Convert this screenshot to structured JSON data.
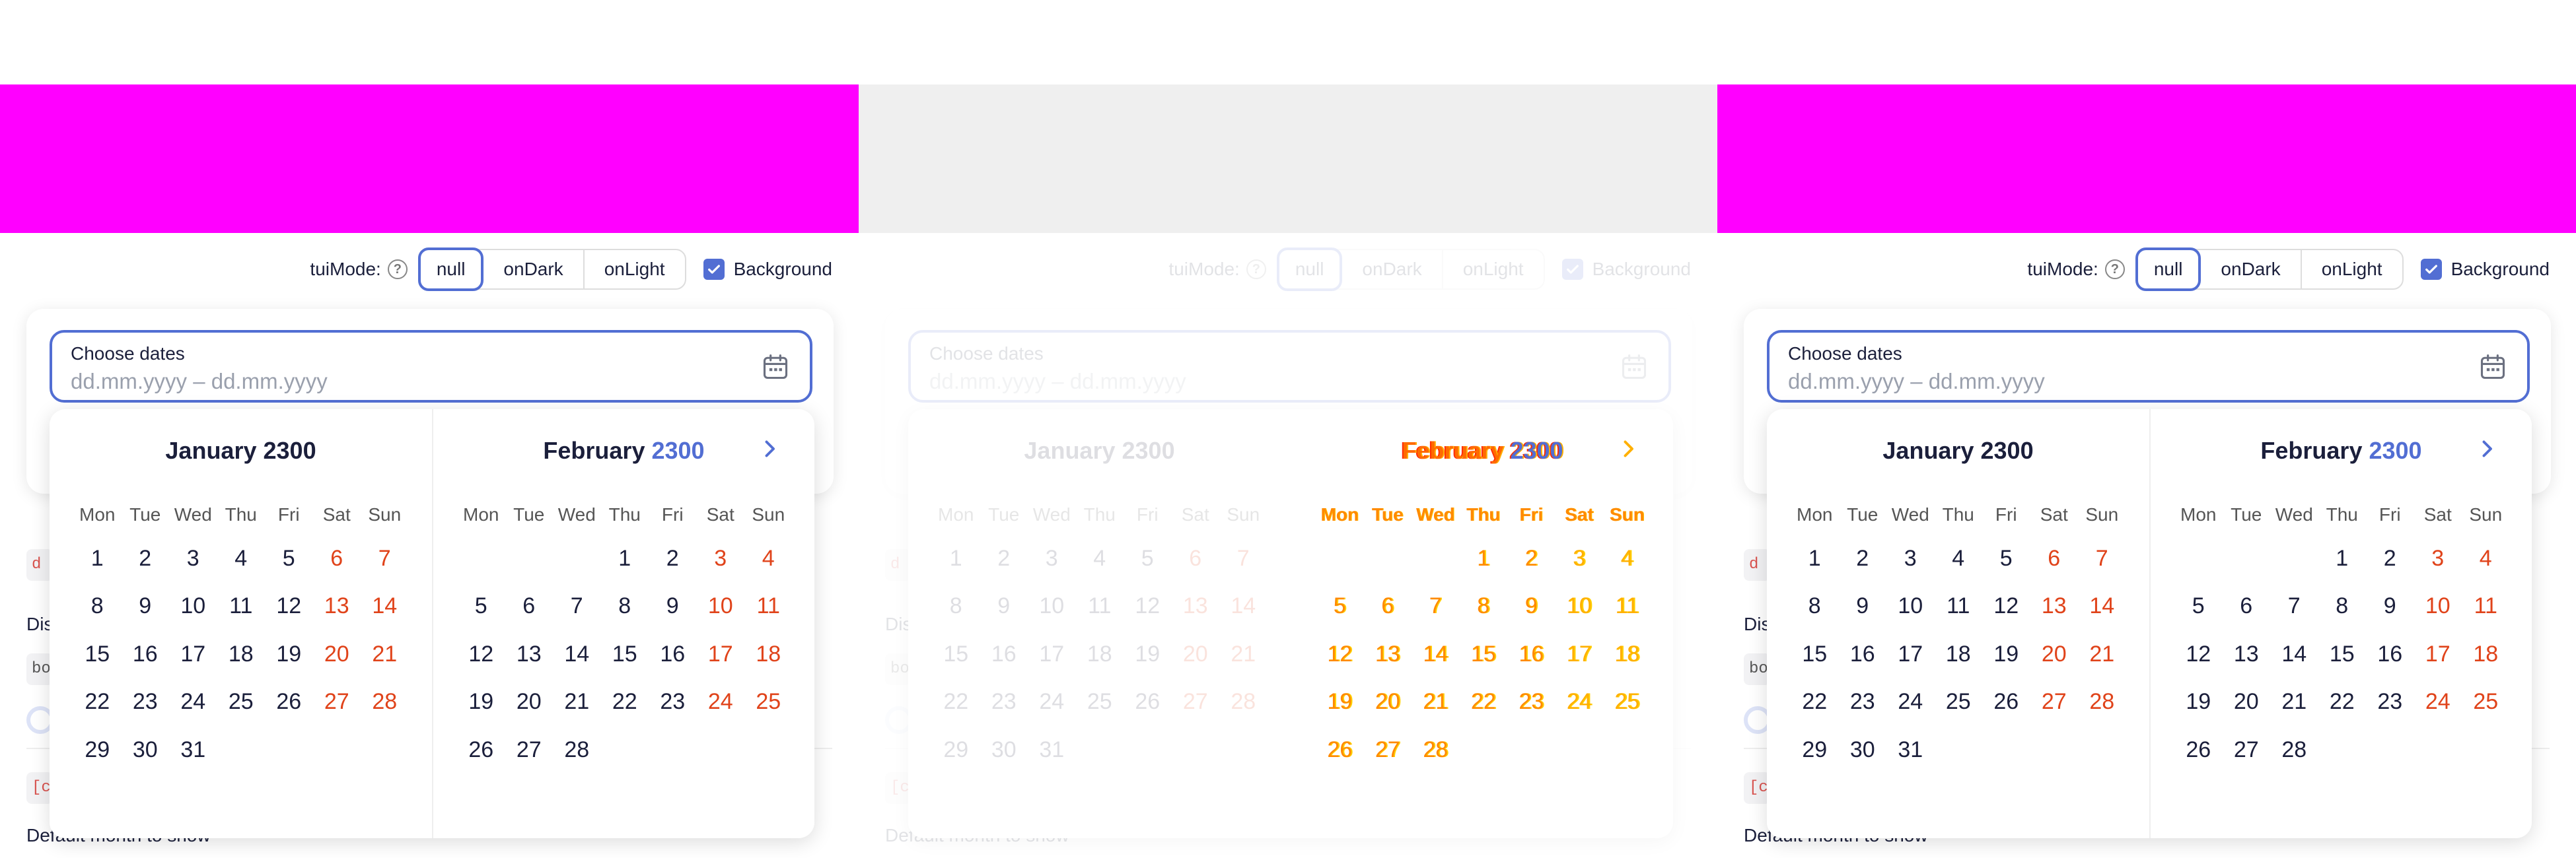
{
  "toolbar": {
    "mode_label": "tuiMode:",
    "modes": [
      "null",
      "onDark",
      "onLight"
    ],
    "background_label": "Background",
    "background_checked": true
  },
  "input": {
    "label": "Choose dates",
    "placeholder": "dd.mm.yyyy – dd.mm.yyyy"
  },
  "below": {
    "tag_short": "d",
    "dis_text": "Dis",
    "tag2": "bo",
    "tag3": "[c",
    "default_month": "Default month to show"
  },
  "calendar": {
    "weekdays": [
      "Mon",
      "Tue",
      "Wed",
      "Thu",
      "Fri",
      "Sat",
      "Sun"
    ],
    "months": [
      {
        "name": "January",
        "year": "2300",
        "offset": 0,
        "days": 31
      },
      {
        "name": "February",
        "year": "2300",
        "offset": 3,
        "days": 28
      }
    ]
  },
  "colors": {
    "accent": "#526ed3",
    "weekend": "#e0431a",
    "banner": "#ff00ff",
    "banner_middle": "#efefef"
  }
}
